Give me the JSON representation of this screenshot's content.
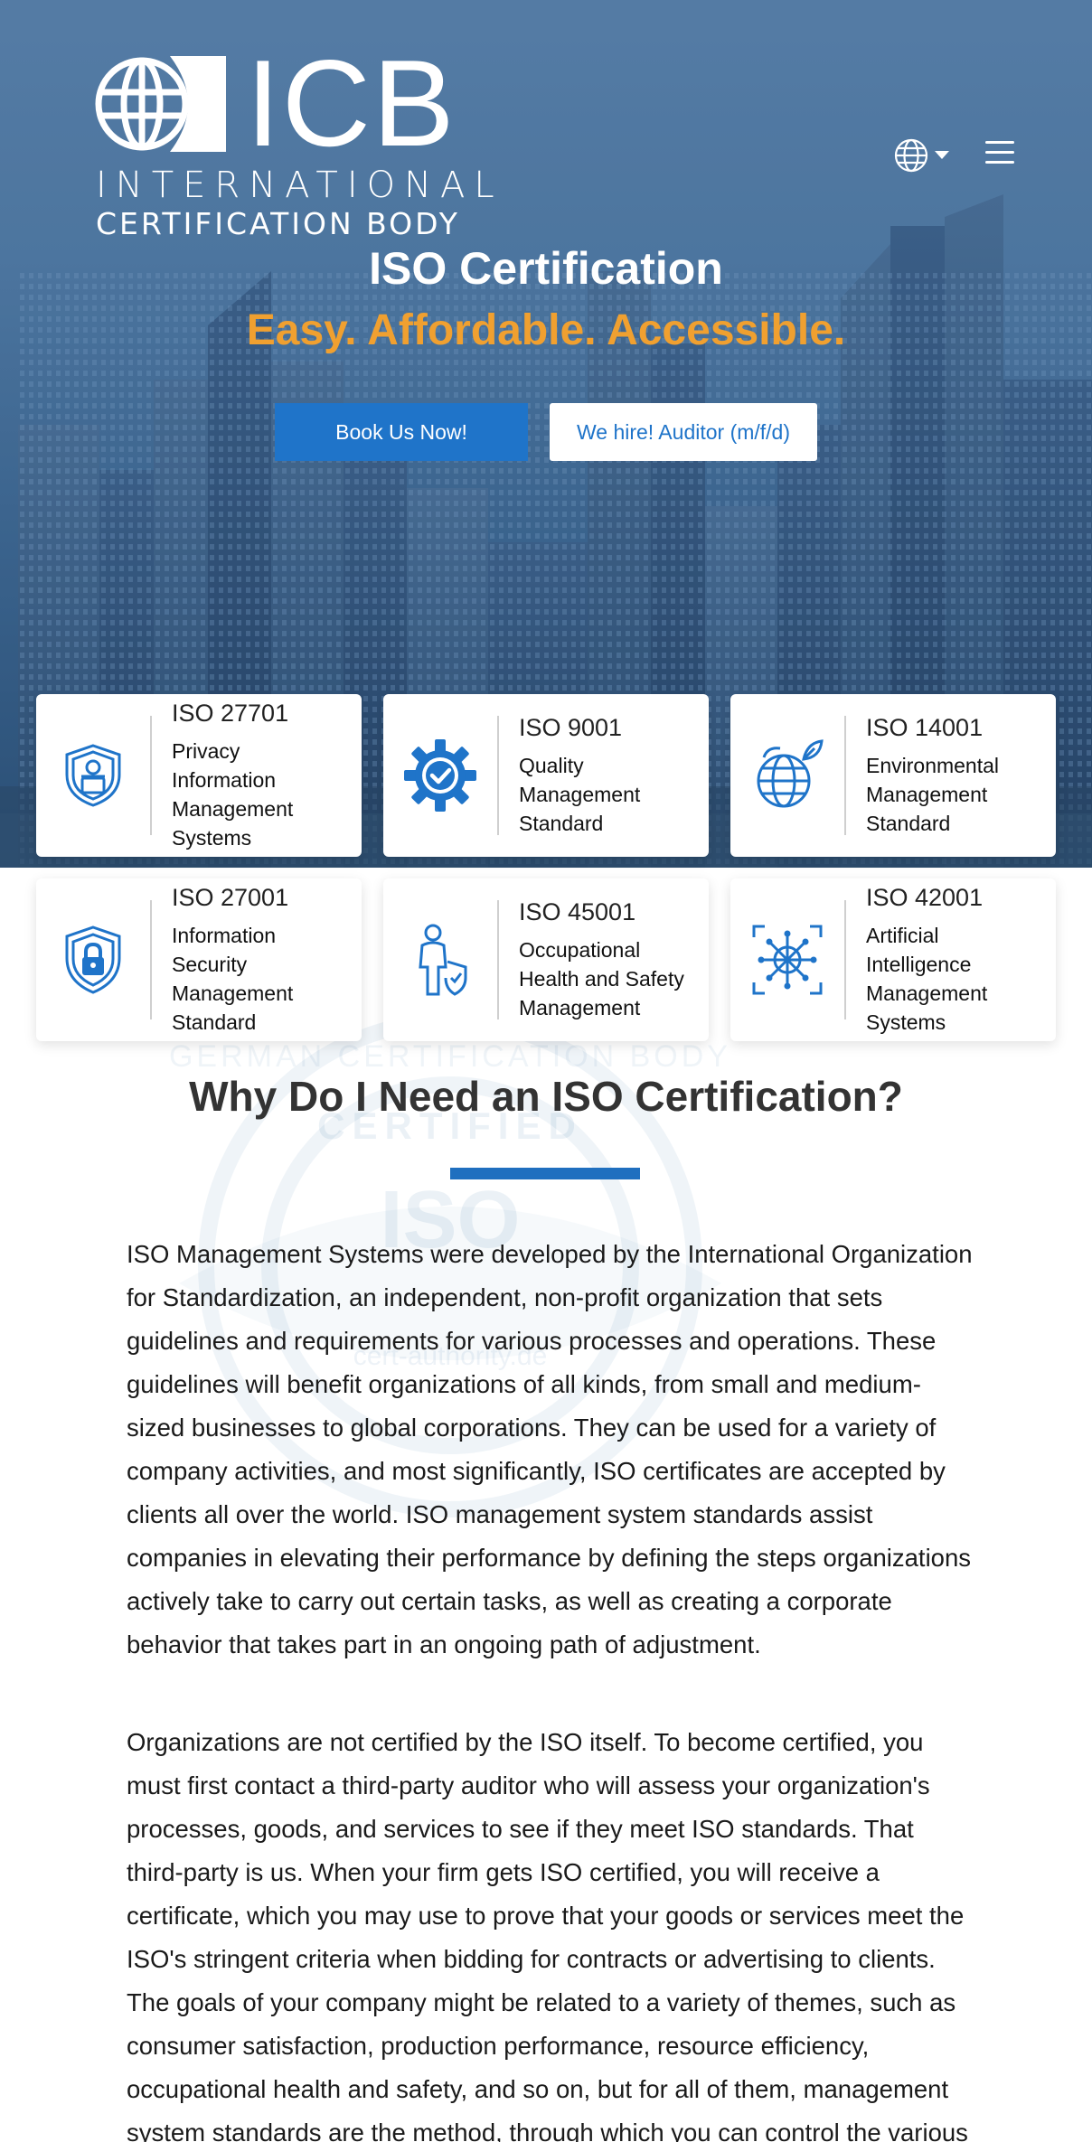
{
  "brand": {
    "wordmark": "ICB",
    "line1": "INTERNATIONAL",
    "line2": "CERTIFICATION BODY"
  },
  "hero": {
    "title": "ISO Certification",
    "subtitle": "Easy. Affordable. Accessible.",
    "book_button": "Book Us Now!",
    "hire_button": "We hire! Auditor (m/f/d)"
  },
  "cards": [
    {
      "code": "ISO 27701",
      "desc": [
        "Privacy",
        "Information",
        "Management",
        "Systems"
      ],
      "icon": "privacy-shield-icon"
    },
    {
      "code": "ISO 9001",
      "desc": [
        "Quality",
        "Management",
        "Standard"
      ],
      "icon": "gear-check-icon"
    },
    {
      "code": "ISO 14001",
      "desc": [
        "Environmental",
        "Management",
        "Standard"
      ],
      "icon": "globe-leaf-icon"
    },
    {
      "code": "ISO 27001",
      "desc": [
        "Information",
        "Security",
        "Management",
        "Standard"
      ],
      "icon": "lock-shield-icon"
    },
    {
      "code": "ISO 45001",
      "desc": [
        "Occupational",
        "Health and Safety",
        "Management"
      ],
      "icon": "worker-shield-icon"
    },
    {
      "code": "ISO 42001",
      "desc": [
        "Artificial",
        "Intelligence",
        "Management",
        "Systems"
      ],
      "icon": "ai-network-icon"
    }
  ],
  "section": {
    "title": "Why Do I Need an ISO Certification?",
    "paragraphs": [
      "ISO Management Systems were developed by the International Organization for Standardization, an independent, non-profit organization that sets guidelines and requirements for various processes and operations. These guidelines will benefit organizations of all kinds, from small and medium-sized businesses to global corporations. They can be used for a variety of company activities, and most significantly, ISO certificates are accepted by clients all over the world. ISO management system standards assist companies in elevating their performance by defining the steps organizations actively take to carry out certain tasks, as well as creating a corporate behavior that takes part in an ongoing path of adjustment.",
      "Organizations are not certified by the ISO itself. To become certified, you must first contact a third-party auditor who will assess your organization's processes, goods, and services to see if they meet ISO standards. That third-party is us. When your firm gets ISO certified, you will receive a certificate, which you may use to prove that your goods or services meet the ISO's stringent criteria when bidding for contracts or advertising to clients. The goals of your company might be related to a variety of themes, such as consumer satisfaction, production performance, resource efficiency, occupational health and safety, and so on, but for all of them, management system standards are the method, through which you can control the various"
    ]
  },
  "watermark": {
    "arc_text": "GERMAN CERTIFICATION BODY",
    "certified": "CERTIFIED",
    "iso": "ISO",
    "site": "cert-authority.de"
  },
  "colors": {
    "accent_blue": "#1f74c9",
    "accent_orange": "#f0a030",
    "rule_blue": "#1f6fbf",
    "text_dark": "#333333"
  }
}
